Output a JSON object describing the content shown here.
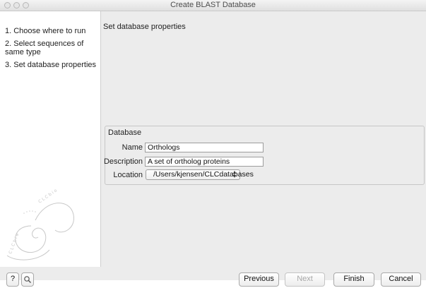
{
  "window": {
    "title": "Create BLAST Database"
  },
  "steps": [
    {
      "label": "1. Choose where to run"
    },
    {
      "label": "2. Select sequences of same type"
    },
    {
      "label": "3. Set database properties"
    }
  ],
  "main": {
    "heading": "Set database properties",
    "group": {
      "label": "Database",
      "name_label": "Name",
      "name_value": "Orthologs",
      "description_label": "Description",
      "description_value": "A set of ortholog proteins",
      "location_label": "Location",
      "location_value": "/Users/kjensen/CLCdatabases"
    }
  },
  "footer": {
    "help_label": "?",
    "previous_label": "Previous",
    "next_label": "Next",
    "finish_label": "Finish",
    "cancel_label": "Cancel"
  },
  "icons": {
    "help": "question-mark-icon",
    "tool": "magnifier-icon",
    "select_arrows": "updown-arrows-icon",
    "logo": "spiral-logo-icon"
  }
}
